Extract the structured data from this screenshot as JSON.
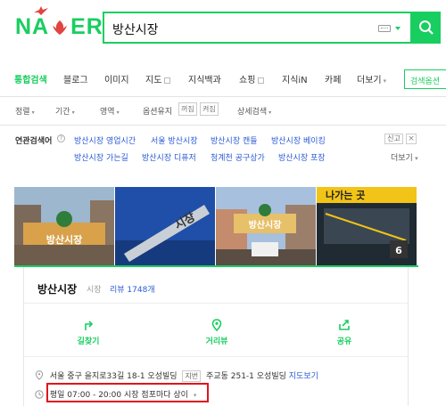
{
  "header": {
    "logo_text": "NAVER",
    "search_query": "방산시장",
    "brand_color": "#19ce60"
  },
  "tabs": [
    {
      "label": "통합검색",
      "active": true
    },
    {
      "label": "블로그"
    },
    {
      "label": "이미지"
    },
    {
      "label": "지도"
    },
    {
      "label": "지식백과"
    },
    {
      "label": "쇼핑"
    },
    {
      "label": "지식iN"
    },
    {
      "label": "카페"
    },
    {
      "label": "더보기"
    }
  ],
  "search_options_label": "검색옵션",
  "filters": {
    "sort": "정렬",
    "period": "기간",
    "area": "영역",
    "keep_options": "옵션유지",
    "keep_off": "꺼짐",
    "keep_on": "켜짐",
    "advanced": "상세검색"
  },
  "related": {
    "label": "연관검색어",
    "row1": [
      "방산시장 영업시간",
      "서울 방산시장",
      "방산시장 캔들",
      "방산시장 베이킹"
    ],
    "row2": [
      "방산시장 가는길",
      "방산시장 디퓨저",
      "청계천 공구상가",
      "방산시장 포장"
    ],
    "report": "신고",
    "more": "더보기"
  },
  "photos": {
    "count_badge": "6",
    "sign_text_1": "방산시장",
    "sign_text_2": "시장",
    "sign_text_3": "방산시장",
    "sign_text_4": "나가는 곳"
  },
  "place": {
    "name": "방산시장",
    "category": "시장",
    "review": "리뷰 1748개",
    "actions": {
      "directions": "길찾기",
      "street_view": "거리뷰",
      "share": "공유"
    },
    "address": "서울 중구 을지로33길 18-1 오성빌딩",
    "lot_label": "지번",
    "lot_address": "주교동 251-1 오성빌딩",
    "map_link": "지도보기",
    "hours": "평일 07:00 - 20:00   시장 점포마다 상이"
  }
}
